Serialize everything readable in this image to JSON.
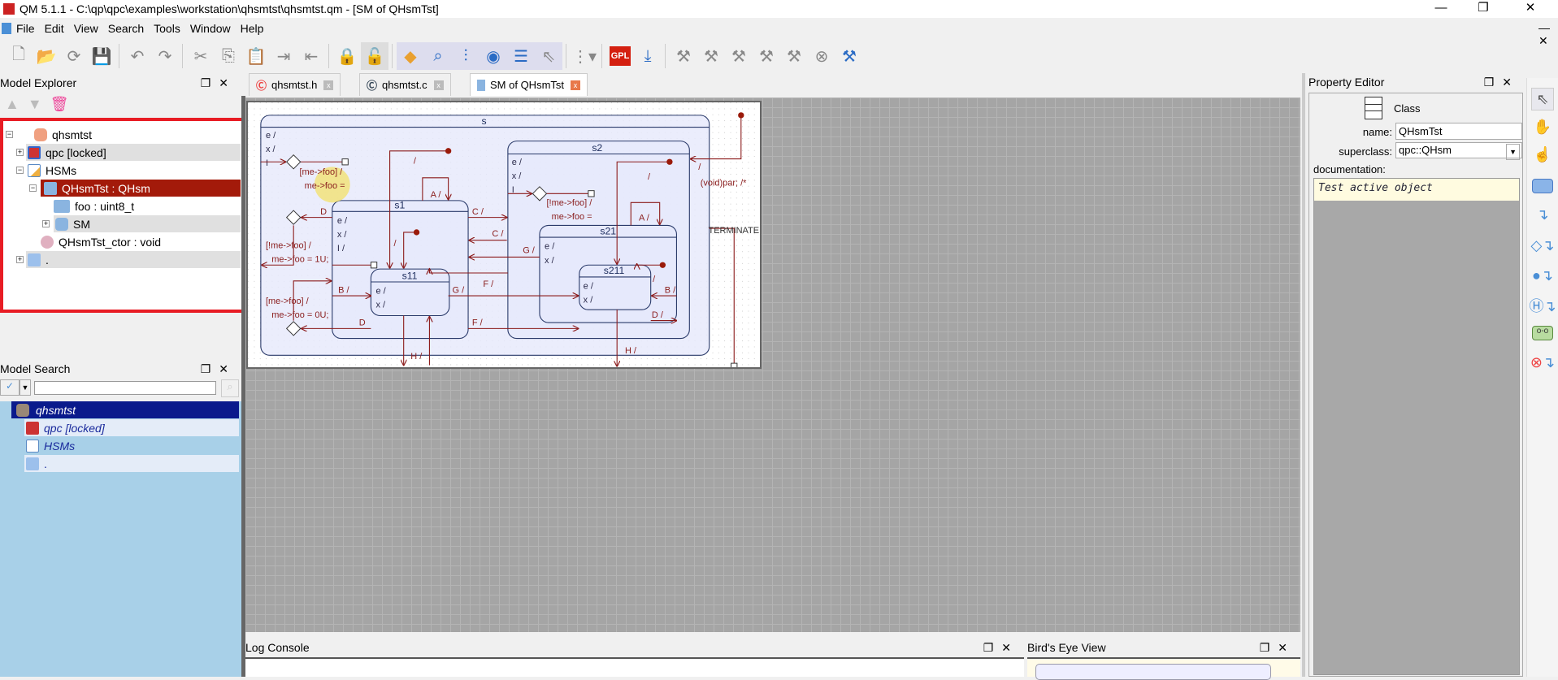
{
  "window": {
    "title": "QM 5.1.1 - C:\\qp\\qpc\\examples\\workstation\\qhsmtst\\qhsmtst.qm - [SM of QHsmTst]",
    "controls": [
      "minimize",
      "restore",
      "close"
    ]
  },
  "menu": [
    "File",
    "Edit",
    "View",
    "Search",
    "Tools",
    "Window",
    "Help"
  ],
  "toolbar": [
    "new-model",
    "open-model",
    "reload",
    "save",
    "undo",
    "redo",
    "cut",
    "copy",
    "paste",
    "export",
    "import",
    "lock",
    "unlock",
    "edit-tool",
    "search-tool",
    "properties",
    "view",
    "list",
    "select",
    "layout",
    "gpl-license",
    "generate-code",
    "build",
    "build-2",
    "build-3",
    "build-4",
    "build-5",
    "cancel",
    "tools"
  ],
  "model_explorer": {
    "title": "Model Explorer",
    "items": [
      {
        "label": "qhsmtst",
        "icon": "database-icon"
      },
      {
        "label": "qpc [locked]",
        "icon": "qp-package-icon"
      },
      {
        "label": "HSMs",
        "icon": "package-icon"
      },
      {
        "label": "QHsmTst : QHsm",
        "icon": "class-icon",
        "selected": true
      },
      {
        "label": "foo : uint8_t",
        "icon": "attribute-icon"
      },
      {
        "label": "SM",
        "icon": "state-machine-icon"
      },
      {
        "label": "QHsmTst_ctor : void",
        "icon": "operation-icon"
      },
      {
        "label": ".",
        "icon": "folder-icon"
      }
    ]
  },
  "model_search": {
    "title": "Model Search",
    "query": "",
    "items": [
      {
        "label": "qhsmtst"
      },
      {
        "label": "qpc [locked]"
      },
      {
        "label": "HSMs"
      },
      {
        "label": "."
      }
    ]
  },
  "tabs": [
    {
      "label": "qhsmtst.h",
      "active": false
    },
    {
      "label": "qhsmtst.c",
      "active": false
    },
    {
      "label": "SM of QHsmTst",
      "active": true
    }
  ],
  "diagram": {
    "states": {
      "s": "s",
      "s1": "s1",
      "s11": "s11",
      "s2": "s2",
      "s21": "s21",
      "s211": "s211"
    },
    "actions": {
      "e": "e /",
      "x": "x /",
      "i": "I",
      "i1": "I /"
    },
    "labels": {
      "s_choice_guard": "[me->foo] /",
      "s_choice_action": "me->foo =",
      "top_init": "/",
      "top_init_action": "(void)par; /*",
      "terminate": "TERMINATE",
      "slash": "/",
      "a": "A /",
      "c1": "C /",
      "c2": "C /",
      "g1": "G /",
      "f1": "F /",
      "g2": "G /",
      "f2": "F /",
      "d1": "D",
      "d2": "D",
      "b1": "B /",
      "h1": "H /",
      "e1": "E /",
      "g_not_foo": "[!me->foo] /",
      "a_foo_1": "me->foo = 1U;",
      "g_foo": "[me->foo] /",
      "a_foo_0": "me->foo = 0U;",
      "s2_guard": "[!me->foo] /",
      "s2_action": "me->foo =",
      "a2": "A /",
      "b2": "B /",
      "d3": "D /",
      "h2": "H /"
    }
  },
  "log_console": {
    "title": "Log Console"
  },
  "birds_eye": {
    "title": "Bird's Eye View"
  },
  "property_editor": {
    "title": "Property Editor",
    "kind": "Class",
    "name_label": "name:",
    "name": "QHsmTst",
    "superclass_label": "superclass:",
    "superclass": "qpc::QHsm",
    "doc_label": "documentation:",
    "documentation": "Test active object"
  },
  "palette": [
    "select-tool",
    "pan-tool",
    "touch-tool",
    "state-tool",
    "transition-tool",
    "choice-transition-tool",
    "initial-transition-tool",
    "history-transition-tool",
    "submachine-tool",
    "terminate-transition-tool"
  ],
  "colors": {
    "selected": "#a31a0a",
    "highlight_border": "#e81c24",
    "search_selected": "#0a1a8c",
    "search_bg": "#a8d0e8",
    "transition": "#8b1a1a"
  }
}
